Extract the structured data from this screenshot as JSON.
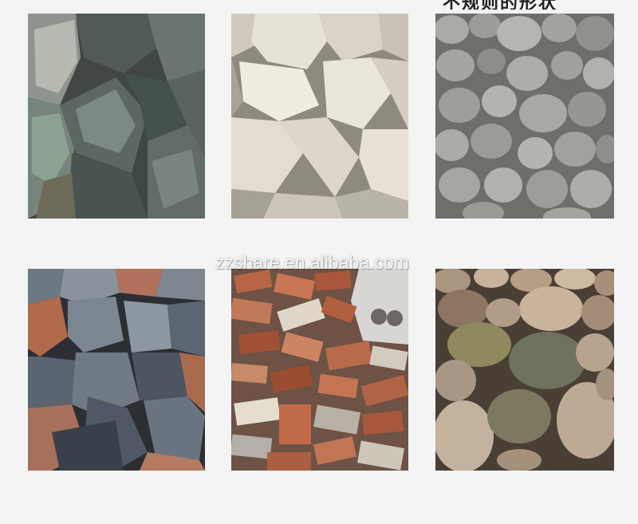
{
  "header": {
    "partial_title": "不规则的形状"
  },
  "watermark": {
    "text": "zzshare.en.alibaba.com"
  },
  "photos": [
    {
      "name": "greenish-grey-rocks",
      "colors": {
        "base": "#5d6863",
        "light": "#8f9a94",
        "dark": "#3a403d"
      }
    },
    {
      "name": "white-limestone",
      "colors": {
        "base": "#d8d3c6",
        "light": "#f0ece2",
        "dark": "#9c978c"
      }
    },
    {
      "name": "grey-river-stones",
      "colors": {
        "base": "#9a9c97",
        "light": "#b9bab5",
        "dark": "#6f716d"
      }
    },
    {
      "name": "blue-red-ore",
      "colors": {
        "base": "#55606a",
        "light": "#7d8790",
        "dark": "#2f353b"
      }
    },
    {
      "name": "brick-debris",
      "colors": {
        "base": "#b76a4a",
        "light": "#d3cbc1",
        "dark": "#7a3f29"
      }
    },
    {
      "name": "brown-pebbles",
      "colors": {
        "base": "#9d8a73",
        "light": "#c9b7a1",
        "dark": "#5d5144"
      }
    }
  ]
}
